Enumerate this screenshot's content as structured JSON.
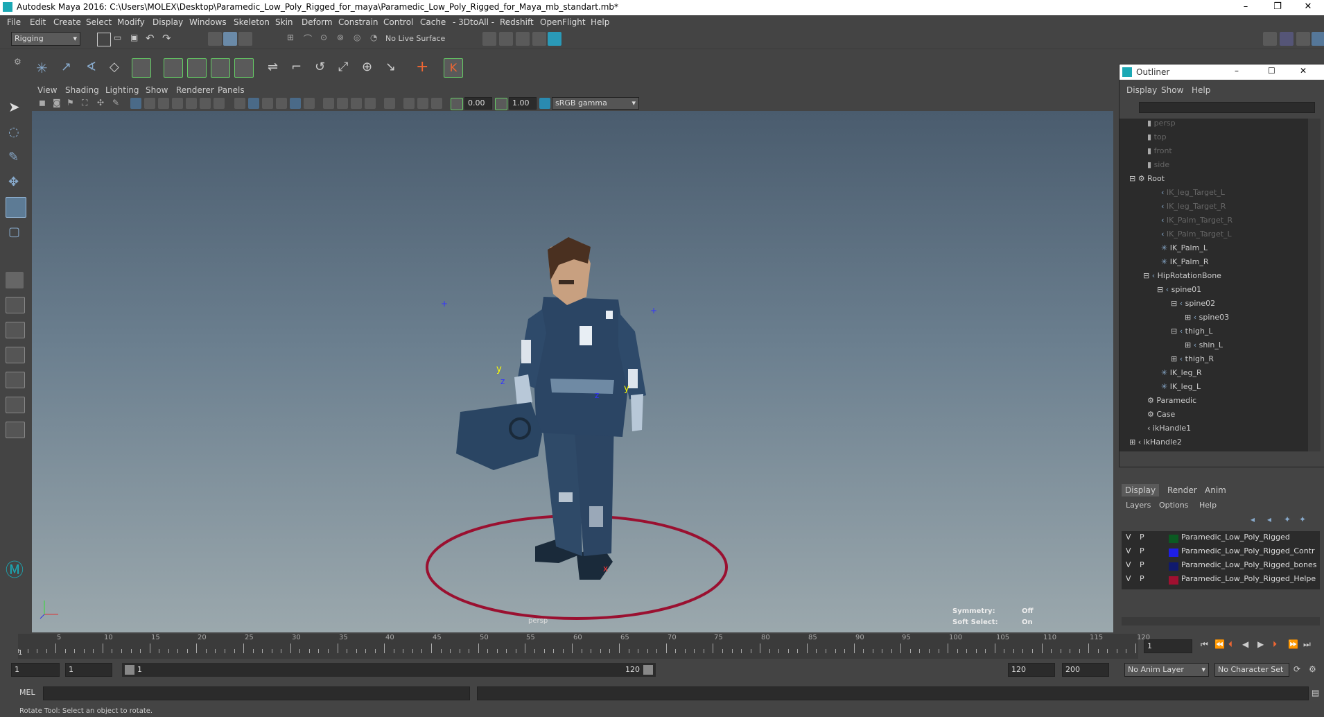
{
  "window": {
    "title": "Autodesk Maya 2016: C:\\Users\\MOLEX\\Desktop\\Paramedic_Low_Poly_Rigged_for_maya\\Paramedic_Low_Poly_Rigged_for_Maya_mb_standart.mb*",
    "minimize": "–",
    "restore": "❐",
    "close": "✕"
  },
  "menubar": [
    "File",
    "Edit",
    "Create",
    "Select",
    "Modify",
    "Display",
    "Windows",
    "Skeleton",
    "Skin",
    "Deform",
    "Constrain",
    "Control",
    "Cache",
    "- 3DtoAll -",
    "Redshift",
    "OpenFlight",
    "Help"
  ],
  "status": {
    "menuset": "Rigging",
    "live_surface": "No Live Surface"
  },
  "viewport": {
    "menu": [
      "View",
      "Shading",
      "Lighting",
      "Show",
      "Renderer",
      "Panels"
    ],
    "near": "0.00",
    "far": "1.00",
    "colorspace": "sRGB gamma",
    "camera_label": "persp",
    "symmetry_label": "Symmetry:",
    "symmetry_value": "Off",
    "softselect_label": "Soft Select:",
    "softselect_value": "On"
  },
  "outliner": {
    "title": "Outliner",
    "menu": [
      "Display",
      "Show",
      "Help"
    ],
    "items": [
      {
        "label": "persp",
        "dim": true
      },
      {
        "label": "top",
        "dim": true
      },
      {
        "label": "front",
        "dim": true
      },
      {
        "label": "side",
        "dim": true
      },
      {
        "label": "Root",
        "dim": false
      },
      {
        "label": "IK_leg_Target_L",
        "dim": true
      },
      {
        "label": "IK_leg_Target_R",
        "dim": true
      },
      {
        "label": "IK_Palm_Target_R",
        "dim": true
      },
      {
        "label": "IK_Palm_Target_L",
        "dim": true
      },
      {
        "label": "IK_Palm_L",
        "dim": false
      },
      {
        "label": "IK_Palm_R",
        "dim": false
      },
      {
        "label": "HipRotationBone",
        "dim": false
      },
      {
        "label": "spine01",
        "dim": false
      },
      {
        "label": "spine02",
        "dim": false
      },
      {
        "label": "spine03",
        "dim": false
      },
      {
        "label": "thigh_L",
        "dim": false
      },
      {
        "label": "shin_L",
        "dim": false
      },
      {
        "label": "thigh_R",
        "dim": false
      },
      {
        "label": "IK_leg_R",
        "dim": false
      },
      {
        "label": "IK_leg_L",
        "dim": false
      },
      {
        "label": "Paramedic",
        "dim": false
      },
      {
        "label": "Case",
        "dim": false
      },
      {
        "label": "ikHandle1",
        "dim": false
      },
      {
        "label": "ikHandle2",
        "dim": false
      }
    ]
  },
  "layers": {
    "tabs": [
      "Display",
      "Render",
      "Anim"
    ],
    "menu": [
      "Layers",
      "Options",
      "Help"
    ],
    "rows": [
      {
        "v": "V",
        "p": "P",
        "color": "#0b5a22",
        "name": "Paramedic_Low_Poly_Rigged"
      },
      {
        "v": "V",
        "p": "P",
        "color": "#1e1ee6",
        "name": "Paramedic_Low_Poly_Rigged_Contr"
      },
      {
        "v": "V",
        "p": "P",
        "color": "#101a6e",
        "name": "Paramedic_Low_Poly_Rigged_bones"
      },
      {
        "v": "V",
        "p": "P",
        "color": "#a01030",
        "name": "Paramedic_Low_Poly_Rigged_Helpe"
      }
    ]
  },
  "timeline": {
    "ticks": [
      "5",
      "10",
      "15",
      "20",
      "25",
      "30",
      "35",
      "40",
      "45",
      "50",
      "55",
      "60",
      "65",
      "70",
      "75",
      "80",
      "85",
      "90",
      "95",
      "100",
      "105",
      "110",
      "115",
      "120"
    ],
    "current_frame": "1",
    "start_label": "1"
  },
  "range": {
    "start": "1",
    "start_inner": "1",
    "slider_start": "1",
    "slider_end": "120",
    "end_inner": "120",
    "end": "200",
    "anim_layer": "No Anim Layer",
    "char_set": "No Character Set"
  },
  "mel": {
    "label": "MEL"
  },
  "help": {
    "text": "Rotate Tool: Select an object to rotate."
  }
}
